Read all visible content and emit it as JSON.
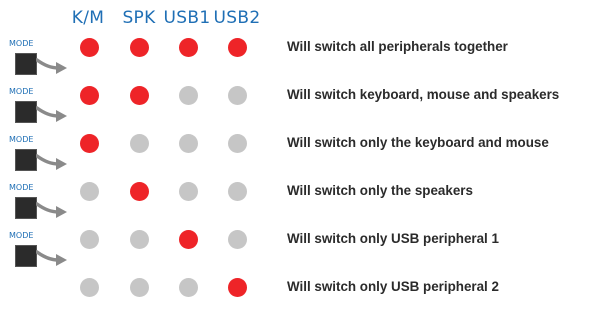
{
  "colors": {
    "header": "#1f6fb5",
    "led_on": "#ee2428",
    "led_off": "#c6c6c6",
    "mode_button": "#2b2b2b",
    "arrow": "#8a8a8a",
    "text": "#2b2b2b"
  },
  "columns": [
    "K/M",
    "SPK",
    "USB1",
    "USB2"
  ],
  "mode_label": "MODE",
  "rows": [
    {
      "leds": [
        true,
        true,
        true,
        true
      ],
      "description": "Will switch all peripherals together"
    },
    {
      "leds": [
        true,
        true,
        false,
        false
      ],
      "description": "Will switch keyboard, mouse and speakers"
    },
    {
      "leds": [
        true,
        false,
        false,
        false
      ],
      "description": "Will switch only the keyboard and mouse"
    },
    {
      "leds": [
        false,
        true,
        false,
        false
      ],
      "description": "Will switch only the speakers"
    },
    {
      "leds": [
        false,
        false,
        true,
        false
      ],
      "description": "Will switch only USB peripheral 1"
    },
    {
      "leds": [
        false,
        false,
        false,
        true
      ],
      "description": "Will switch only USB peripheral 2"
    }
  ]
}
